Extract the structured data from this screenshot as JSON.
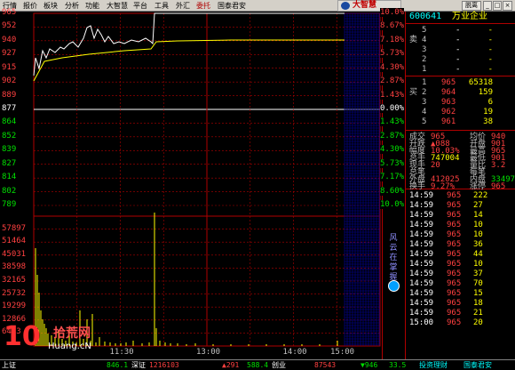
{
  "menu": {
    "items": [
      {
        "label": "行情"
      },
      {
        "label": "报价"
      },
      {
        "label": "板块"
      },
      {
        "label": "分析"
      },
      {
        "label": "功能"
      },
      {
        "label": "大智慧"
      },
      {
        "label": "平台"
      },
      {
        "label": "工具"
      },
      {
        "label": "外汇"
      },
      {
        "label": "委托"
      },
      {
        "label": "国泰君安"
      }
    ],
    "logo_text": "大智慧",
    "ctrl_label": "脱离"
  },
  "chart": {
    "price_labels": [
      "965",
      "952",
      "940",
      "927",
      "915",
      "902",
      "889",
      "877",
      "864",
      "852",
      "839",
      "827",
      "814",
      "802",
      "789"
    ],
    "pct_labels": [
      "10.0%",
      "8.67%",
      "7.18%",
      "5.73%",
      "4.30%",
      "2.87%",
      "1.43%",
      "0.00%",
      "1.43%",
      "2.87%",
      "4.30%",
      "5.73%",
      "7.17%",
      "8.60%",
      "10.0%"
    ],
    "volume_labels": [
      "57897",
      "51464",
      "45031",
      "38598",
      "32165",
      "25732",
      "19299",
      "12866",
      "6433"
    ],
    "time_labels": [
      "11:30",
      "13:00",
      "14:00",
      "15:00"
    ],
    "prev_close_value": 8.77,
    "limit_up_value": 9.65,
    "colors": {
      "grid": "#b00000",
      "price": "#ffffff",
      "avg": "#ffff00",
      "volume": "#ffff00",
      "border": "#b00000"
    }
  },
  "sidetab": {
    "label": "风云在掌握"
  },
  "quote": {
    "code": "600641",
    "name": "万业企业",
    "sell_label": "卖",
    "buy_label": "买",
    "sell_levels": [
      {
        "level": "5",
        "price": "-",
        "vol": "-"
      },
      {
        "level": "4",
        "price": "-",
        "vol": "-"
      },
      {
        "level": "3",
        "price": "-",
        "vol": "-"
      },
      {
        "level": "2",
        "price": "-",
        "vol": "-"
      },
      {
        "level": "1",
        "price": "-",
        "vol": "-"
      }
    ],
    "buy_levels": [
      {
        "level": "1",
        "price": "965",
        "vol": "65318"
      },
      {
        "level": "2",
        "price": "964",
        "vol": "159"
      },
      {
        "level": "3",
        "price": "963",
        "vol": "6"
      },
      {
        "level": "4",
        "price": "962",
        "vol": "19"
      },
      {
        "level": "5",
        "price": "961",
        "vol": "38"
      }
    ],
    "stats": [
      {
        "label": "成交",
        "value": "965",
        "label2": "均价",
        "value2": "940"
      },
      {
        "label": "升跌",
        "value": "▲088",
        "label2": "开盘",
        "value2": "901"
      },
      {
        "label": "幅度",
        "value": "10.03%",
        "label2": "最高",
        "value2": "965"
      },
      {
        "label": "总手",
        "value": "747004",
        "label2": "最低",
        "value2": "901"
      },
      {
        "label": "现手",
        "value": "20",
        "label2": "量比",
        "value2": "3.2"
      },
      {
        "label": "总笔",
        "value": "",
        "label2": "每笔",
        "value2": ""
      },
      {
        "label": "外盘",
        "value": "412025",
        "label2": "内盘",
        "value2": "334979"
      },
      {
        "label": "换手",
        "value": "9.27%",
        "label2": "涨停",
        "value2": "965"
      }
    ],
    "ticks": [
      {
        "time": "14:59",
        "price": "965",
        "vol": "222"
      },
      {
        "time": "14:59",
        "price": "965",
        "vol": "27"
      },
      {
        "time": "14:59",
        "price": "965",
        "vol": "14"
      },
      {
        "time": "14:59",
        "price": "965",
        "vol": "10"
      },
      {
        "time": "14:59",
        "price": "965",
        "vol": "10"
      },
      {
        "time": "14:59",
        "price": "965",
        "vol": "36"
      },
      {
        "time": "14:59",
        "price": "965",
        "vol": "44"
      },
      {
        "time": "14:59",
        "price": "965",
        "vol": "10"
      },
      {
        "time": "14:59",
        "price": "965",
        "vol": "37"
      },
      {
        "time": "14:59",
        "price": "965",
        "vol": "70"
      },
      {
        "time": "14:59",
        "price": "965",
        "vol": "15"
      },
      {
        "time": "14:59",
        "price": "965",
        "vol": "18"
      },
      {
        "time": "14:59",
        "price": "965",
        "vol": "21"
      },
      {
        "time": "15:00",
        "price": "965",
        "vol": "20"
      }
    ]
  },
  "status": {
    "seg1": "上证",
    "seg2": "846.1",
    "seg3": "深证",
    "seg4": "1216103",
    "seg5": "▲291",
    "seg6": "588.4",
    "seg7": "创业",
    "seg8": "87543",
    "seg9": "▼946",
    "seg10": "33.5",
    "seg11": "投资理财",
    "seg12": "国泰君安"
  },
  "watermark": {
    "number": "10",
    "cn": "拾荒网",
    "url": "Huang.cN"
  }
}
